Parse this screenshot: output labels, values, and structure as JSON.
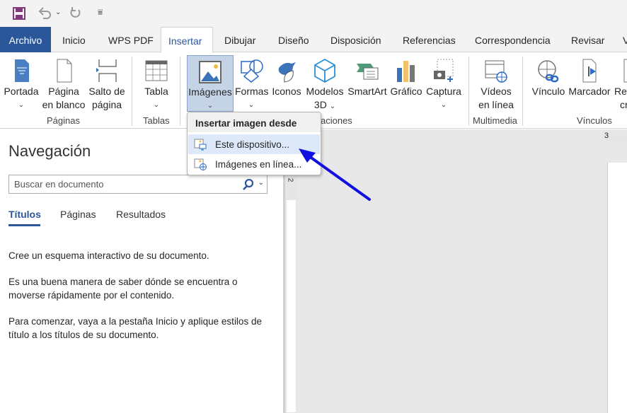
{
  "qat": {
    "save": "save-icon",
    "undo": "undo-icon",
    "redo": "redo-icon",
    "customize": "customize-icon"
  },
  "tabs": [
    "Archivo",
    "Inicio",
    "WPS PDF",
    "Insertar",
    "Dibujar",
    "Diseño",
    "Disposición",
    "Referencias",
    "Correspondencia",
    "Revisar",
    "V"
  ],
  "ribbon": {
    "portada": "Portada",
    "pagina_blanco_1": "Página",
    "pagina_blanco_2": "en blanco",
    "salto_1": "Salto de",
    "salto_2": "página",
    "paginas_group": "Páginas",
    "tabla": "Tabla",
    "tablas_group": "Tablas",
    "imagenes": "Imágenes",
    "formas": "Formas",
    "iconos": "Iconos",
    "modelos_1": "Modelos",
    "modelos_2": "3D",
    "smartart": "SmartArt",
    "grafico": "Gráfico",
    "captura": "Captura",
    "ilustraciones_group": "aciones",
    "videos_1": "Vídeos",
    "videos_2": "en línea",
    "multimedia_group": "Multimedia",
    "vinculo": "Vínculo",
    "marcador": "Marcador",
    "ref_1": "Ref",
    "ref_2": "cr",
    "vinculos_group": "Vínculos"
  },
  "menu": {
    "header": "Insertar imagen desde",
    "items": [
      "Este dispositivo...",
      "Imágenes en línea..."
    ]
  },
  "nav": {
    "title": "Navegación",
    "search_placeholder": "Buscar en documento",
    "tabs": [
      "Títulos",
      "Páginas",
      "Resultados"
    ],
    "p1": "Cree un esquema interactivo de su documento.",
    "p2": "Es una buena manera de saber dónde se encuentra o moverse rápidamente por el contenido.",
    "p3": "Para comenzar, vaya a la pestaña Inicio y aplique estilos de título a los títulos de su documento."
  },
  "ruler": {
    "h_mark": "3",
    "v_mark": "2"
  },
  "colors": {
    "accent": "#2b579a",
    "arrow": "#1010e0"
  }
}
